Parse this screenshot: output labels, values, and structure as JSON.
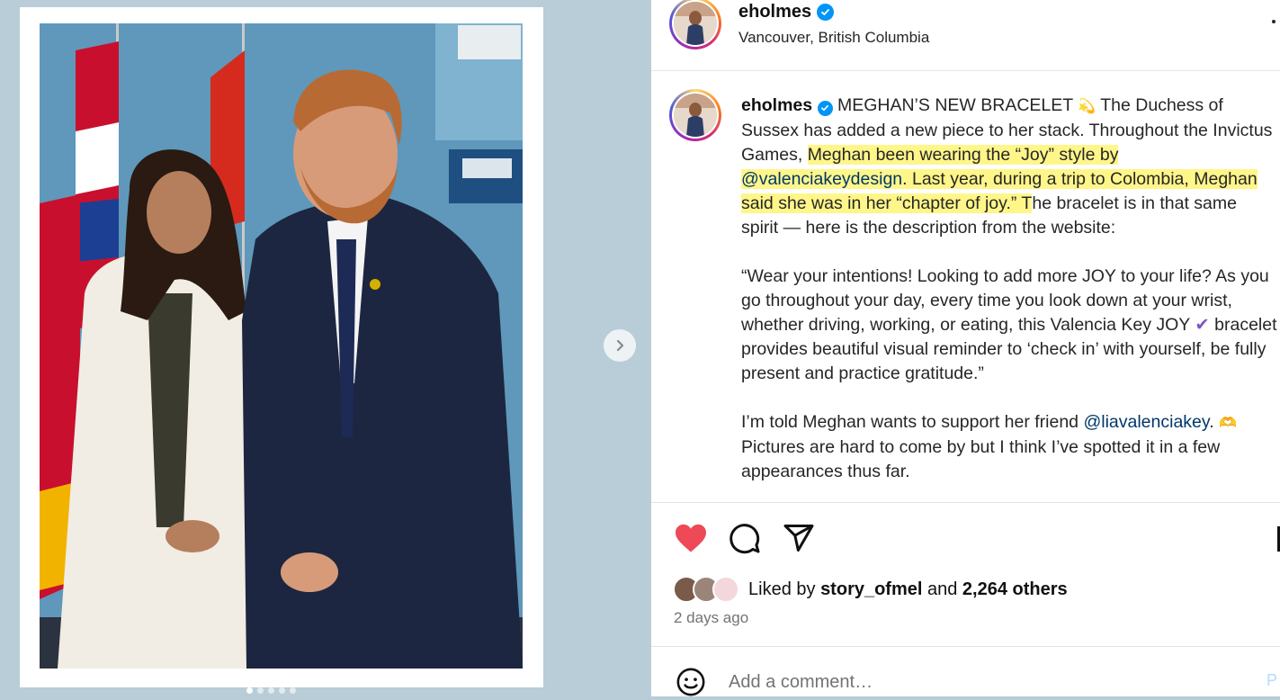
{
  "post": {
    "username": "eholmes",
    "location": "Vancouver, British Columbia",
    "verified": true
  },
  "caption": {
    "username": "eholmes",
    "title": "MEGHAN’S NEW BRACELET",
    "title_emoji": "💫",
    "p1_a": "The Duchess of Sussex has added a new piece to her stack. Throughout the Invictus Games, ",
    "p1_hl1": "Meghan been wearing the “Joy” style by ",
    "p1_mention": "@valenciakeydesign",
    "p1_hl2": ". Last year, during a trip to Colombia, Meghan said she was in her “chapter of joy.” T",
    "p1_b": "he bracelet is in that same spirit — here is the description from the website:",
    "p2_a": "“Wear your intentions! Looking to add more JOY to your life? As you go throughout your day, every time you look down at your wrist, whether driving, working, or eating, this Valencia Key JOY",
    "p2_emoji": "✔",
    "p2_b": " bracelet provides beautiful visual reminder to ‘check in’ with yourself, be fully present and practice gratitude.”",
    "p3_a": "I’m told Meghan wants to support her friend ",
    "p3_mention": "@liavalenciakey",
    "p3_emoji": "🫶",
    "p3_b": " Pictures are hard to come by but I think I’ve spotted it in a few appearances thus far."
  },
  "actions": {
    "like_icon": "heart-filled-icon",
    "comment_icon": "comment-bubble-icon",
    "share_icon": "paper-plane-icon",
    "like_color": "#ed4956"
  },
  "likes": {
    "prefix": "Liked by ",
    "user": "story_ofmel",
    "middle": " and ",
    "count": "2,264 others"
  },
  "timestamp": "2 days ago",
  "comment": {
    "placeholder": "Add a comment…",
    "post_label": "P"
  },
  "carousel": {
    "slides": 5,
    "active_index": 0
  }
}
